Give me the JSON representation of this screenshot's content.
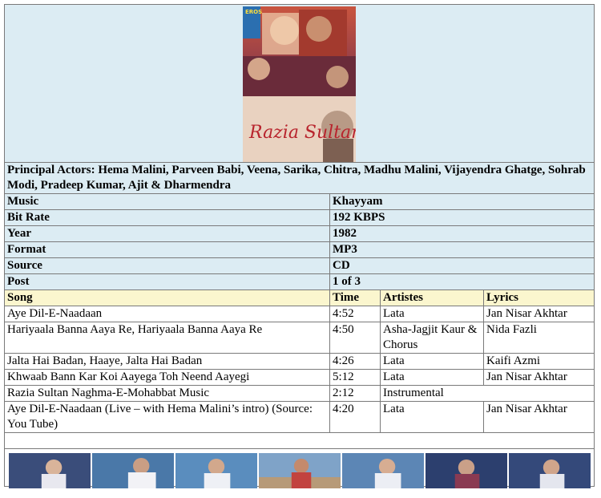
{
  "poster": {
    "title_art": "Razia Sultan",
    "studio_logo": "EROS"
  },
  "actors": {
    "label": "Principal Actors:",
    "value": "Hema Malini, Parveen Babi, Veena, Sarika, Chitra, Madhu Malini, Vijayendra Ghatge, Sohrab Modi, Pradeep Kumar, Ajit & Dharmendra"
  },
  "info": [
    {
      "label": "Music",
      "value": "Khayyam"
    },
    {
      "label": "Bit Rate",
      "value": "192 KBPS"
    },
    {
      "label": "Year",
      "value": "1982"
    },
    {
      "label": "Format",
      "value": "MP3"
    },
    {
      "label": "Source",
      "value": "CD"
    },
    {
      "label": "Post",
      "value": "1 of 3"
    }
  ],
  "songs_header": {
    "song": "Song",
    "time": "Time",
    "artistes": "Artistes",
    "lyrics": "Lyrics"
  },
  "songs": [
    {
      "song": "Aye Dil-E-Naadaan",
      "time": "4:52",
      "artistes": "Lata",
      "lyrics": "Jan Nisar Akhtar"
    },
    {
      "song": "Hariyaala Banna Aaya Re, Hariyaala Banna Aaya Re",
      "time": "4:50",
      "artistes": "Asha-Jagjit Kaur & Chorus",
      "lyrics": "Nida Fazli"
    },
    {
      "song": "Jalta Hai Badan, Haaye, Jalta Hai Badan",
      "time": "4:26",
      "artistes": "Lata",
      "lyrics": "Kaifi Azmi"
    },
    {
      "song": "Khwaab Bann Kar Koi Aayega Toh Neend Aayegi",
      "time": "5:12",
      "artistes": "Lata",
      "lyrics": "Jan Nisar Akhtar"
    },
    {
      "song": "Razia Sultan Naghma-E-Mohabbat Music",
      "time": "2:12",
      "artistes": "Instrumental",
      "lyrics": ""
    },
    {
      "song": "Aye Dil-E-Naadaan (Live – with Hema Malini’s intro) (Source: You Tube)",
      "time": "4:20",
      "artistes": "Lata",
      "lyrics": "Jan Nisar Akhtar"
    }
  ],
  "colors": {
    "panel_bg": "#dcecf3",
    "header_bg": "#fbf6ce",
    "border": "#7a7a7a"
  }
}
